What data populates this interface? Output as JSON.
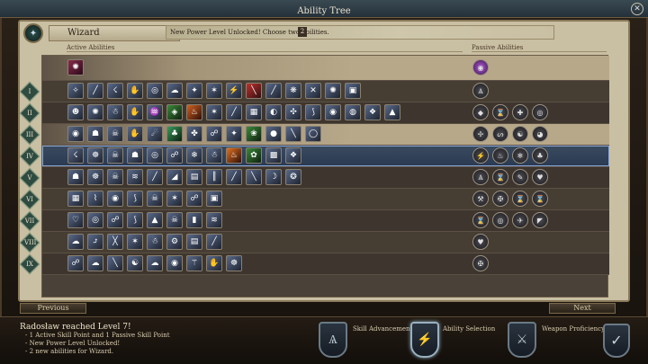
{
  "window": {
    "title": "Ability Tree"
  },
  "class": {
    "name": "Wizard",
    "notice": "New Power Level Unlocked! Choose two abilities.",
    "count": "2"
  },
  "headers": {
    "active": "Active Abilities",
    "passive": "Passive Abilities"
  },
  "levels": [
    "I",
    "II",
    "III",
    "IV",
    "V",
    "VI",
    "VII",
    "VIII",
    "IX"
  ],
  "nav": {
    "previous": "Previous",
    "next": "Next"
  },
  "log": {
    "heading": "Radosław reached Level 7!",
    "lines": [
      "- 1 Active Skill Point and 1 Passive Skill Point",
      "- New Power Level Unlocked!",
      "- 2 new abilities for Wizard."
    ]
  },
  "steps": {
    "skill": "Skill Advancement",
    "ability": "Ability Selection",
    "weapon": "Weapon Proficiency"
  }
}
